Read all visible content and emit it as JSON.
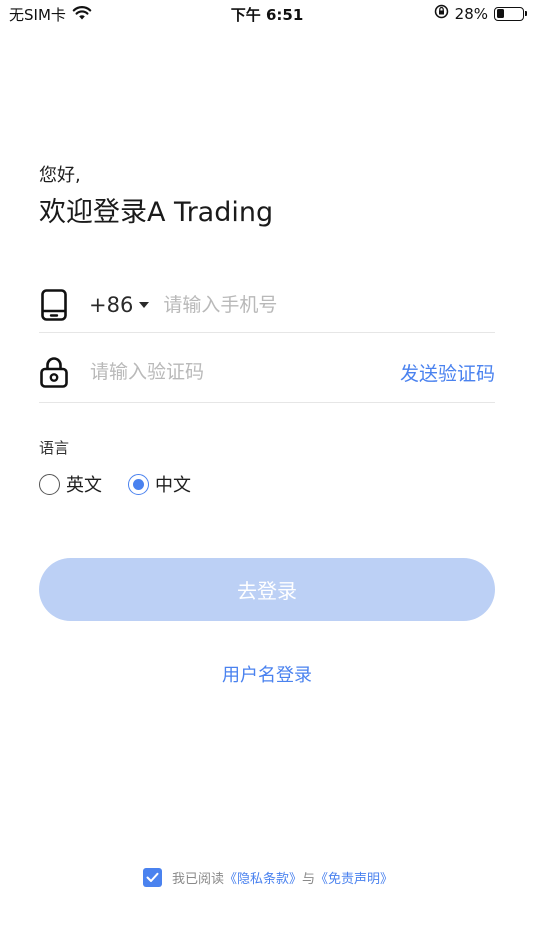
{
  "status_bar": {
    "carrier": "无SIM卡",
    "time": "下午 6:51",
    "battery_percent": "28%",
    "battery_level": 0.28,
    "icons": [
      "wifi-icon",
      "rotation-lock-icon",
      "battery-icon"
    ]
  },
  "header": {
    "greeting": "您好,",
    "title": "欢迎登录A Trading"
  },
  "phone_row": {
    "icon": "phone-icon",
    "country_code": "+86",
    "placeholder": "请输入手机号",
    "value": ""
  },
  "code_row": {
    "icon": "lock-icon",
    "placeholder": "请输入验证码",
    "value": "",
    "send_label": "发送验证码"
  },
  "language": {
    "label": "语言",
    "options": [
      {
        "label": "英文",
        "selected": false
      },
      {
        "label": "中文",
        "selected": true
      }
    ]
  },
  "login_button": "去登录",
  "username_login": "用户名登录",
  "agreement": {
    "checked": true,
    "prefix": "我已阅读",
    "privacy": "《隐私条款》",
    "joiner": "与",
    "disclaimer": "《免责声明》"
  },
  "colors": {
    "accent": "#4a82ef",
    "button_disabled": "#bcd0f5",
    "placeholder": "#b9b9b9"
  }
}
